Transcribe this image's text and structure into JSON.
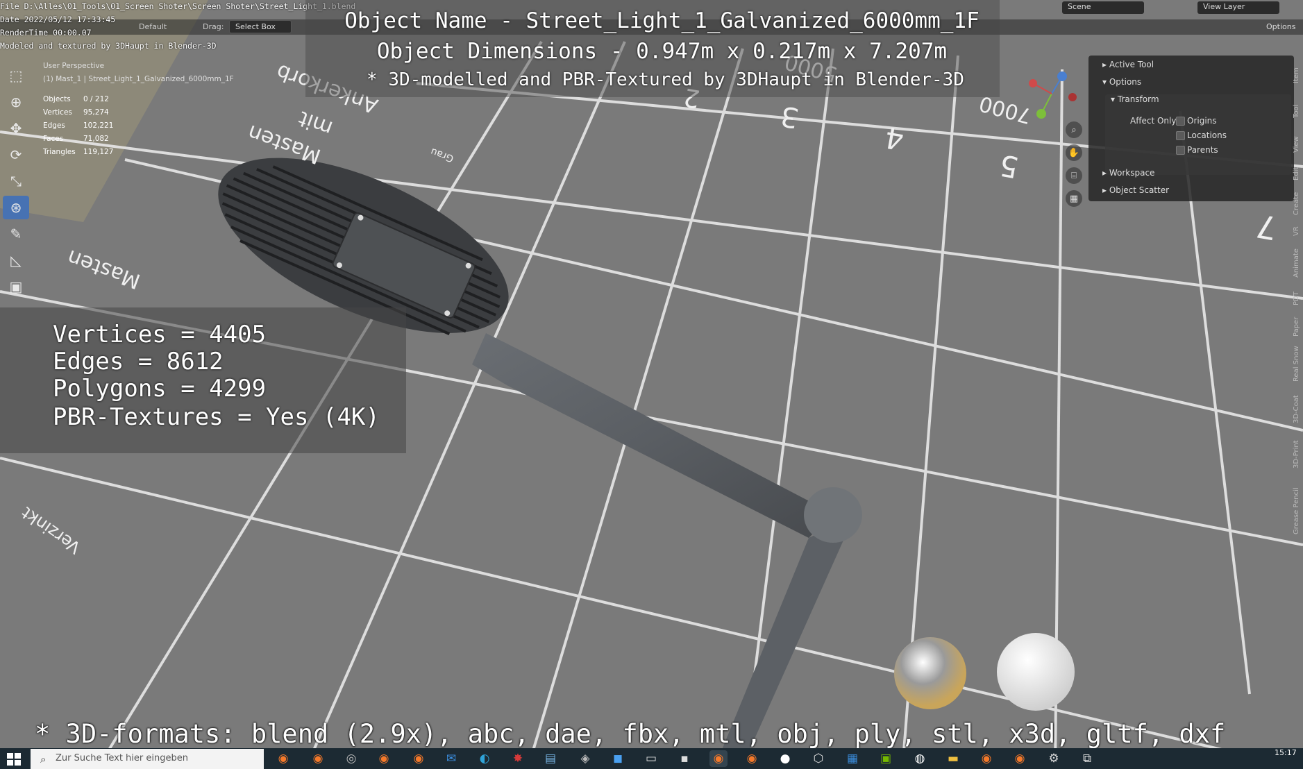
{
  "metadata_lines": {
    "file": "File D:\\Alles\\01_Tools\\01_Screen Shoter\\Screen Shoter\\Street_Light_1.blend",
    "date": "Date 2022/05/12 17:33:45",
    "render_time": "RenderTime 00:00.07",
    "credit": "Modeled and textured by 3DHaupt in Blender-3D"
  },
  "header": {
    "orientation_label": "Default",
    "drag_label": "Drag:",
    "drag_value": "Select Box",
    "scene_name": "Scene",
    "view_layer": "View Layer",
    "options_label": "Options"
  },
  "overlay": {
    "object_name": "Object Name - Street_Light_1_Galvanized_6000mm_1F",
    "object_dimensions": "Object Dimensions -  0.947m x 0.217m x 7.207m",
    "credit_line": "* 3D-modelled and PBR-Textured by 3DHaupt in Blender-3D"
  },
  "viewport": {
    "perspective": "User Perspective",
    "collection": "(1) Mast_1 | Street_Light_1_Galvanized_6000mm_1F",
    "stats": [
      {
        "key": "Objects",
        "value": "0 / 212"
      },
      {
        "key": "Vertices",
        "value": "95,274"
      },
      {
        "key": "Edges",
        "value": "102,221"
      },
      {
        "key": "Faces",
        "value": "71,082"
      },
      {
        "key": "Triangles",
        "value": "119,127"
      }
    ]
  },
  "info_box": {
    "vertices": "Vertices = 4405",
    "edges": "Edges = 8612",
    "polygons": "Polygons = 4299",
    "textures": "PBR-Textures =  Yes (4K)"
  },
  "floor_labels": {
    "masten_top": "Masten",
    "mit": "mit",
    "ankerkorb": "Ankerkorb",
    "masten_left": "Masten",
    "verzinkt": "Verzinkt",
    "grau": "Grau",
    "n2": "2",
    "n3": "3",
    "n4": "4",
    "n5": "5",
    "n7": "7",
    "mm7000": "7000",
    "mm5000": "5000"
  },
  "right_panel": {
    "active_tool": "Active Tool",
    "options": "Options",
    "transform": "Transform",
    "affect_only": "Affect Only",
    "origins": "Origins",
    "locations": "Locations",
    "parents": "Parents",
    "workspace": "Workspace",
    "object_scatter": "Object Scatter"
  },
  "vertical_tabs": [
    "Item",
    "Tool",
    "View",
    "Edit",
    "Create",
    "VR",
    "Animate",
    "PDT",
    "Paper",
    "Real Snow",
    "3D-Coat",
    "3D-Print",
    "Grease Pencil"
  ],
  "formats_line": "* 3D-formats: blend (2.9x), abc, dae, fbx, mtl, obj, ply, stl, x3d, gltf, dxf",
  "taskbar": {
    "search_placeholder": "Zur Suche Text hier eingeben",
    "time": "15:17"
  },
  "colors": {
    "accent": "#4772b3",
    "panel_bg": "#262626",
    "floor": "#7c7c7c",
    "taskbar": "#1c2a33"
  }
}
